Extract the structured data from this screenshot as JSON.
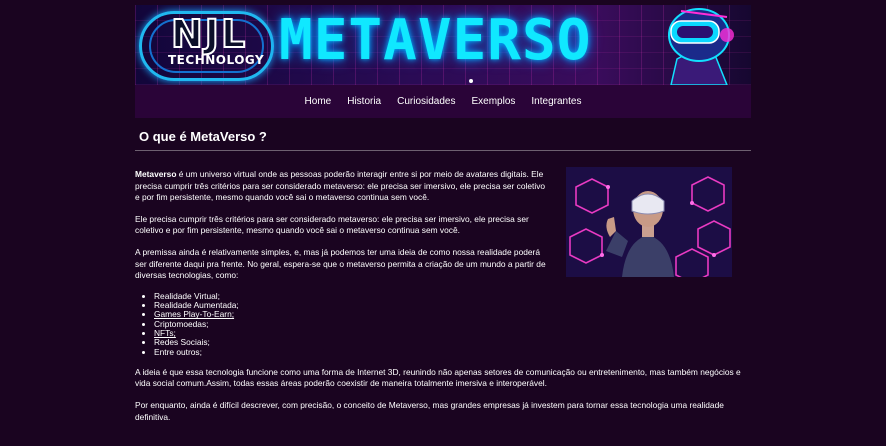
{
  "banner": {
    "logo_main": "NJL",
    "logo_sub": "TECHNOLOGY",
    "title": "METAVERSO"
  },
  "nav": {
    "items": [
      "Home",
      "Historia",
      "Curiosidades",
      "Exemplos",
      "Integrantes"
    ]
  },
  "section": {
    "title": "O que é MetaVerso ?"
  },
  "article": {
    "p1_strong": "Metaverso",
    "p1_rest": " é um universo virtual onde as pessoas poderão interagir entre si por meio de avatares digitais. Ele precisa cumprir três critérios para ser considerado metaverso: ele precisa ser imersivo, ele precisa ser coletivo e por fim persistente, mesmo quando você sai o metaverso continua sem você.",
    "p2": " Ele precisa cumprir três critérios para ser considerado metaverso: ele precisa ser imersivo, ele precisa ser coletivo e por fim persistente, mesmo quando você sai o metaverso continua sem você.",
    "p3": " A premissa ainda é relativamente simples, e, mas já podemos ter uma ideia de como nossa realidade poderá ser diferente daqui pra frente. No geral, espera-se que o metaverso permita a criação de um mundo a partir de diversas tecnologias, como:",
    "list": [
      {
        "text": "Realidade Virtual;",
        "link": false
      },
      {
        "text": "Realidade Aumentada;",
        "link": false
      },
      {
        "text": "Games Play-To-Earn;",
        "link": true
      },
      {
        "text": "Criptomoedas;",
        "link": false
      },
      {
        "text": "NFTs;",
        "link": true
      },
      {
        "text": "Redes Sociais;",
        "link": false
      },
      {
        "text": "Entre outros;",
        "link": false
      }
    ],
    "p4": " A ideia é que essa tecnologia funcione como uma forma de Internet 3D, reunindo não apenas setores de comunicação ou entretenimento, mas também negócios e vida social comum.Assim, todas essas áreas poderão coexistir de maneira totalmente imersiva e interoperável.",
    "p5": " Por enquanto, ainda é difícil descrever, com precisão, o conceito de Metaverso, mas grandes empresas já investem para tornar essa tecnologia uma realidade definitiva."
  },
  "colors": {
    "background": "#1a0420",
    "navbar": "#2a0438",
    "banner_title": "#10e8ff",
    "text": "#ffffff"
  }
}
